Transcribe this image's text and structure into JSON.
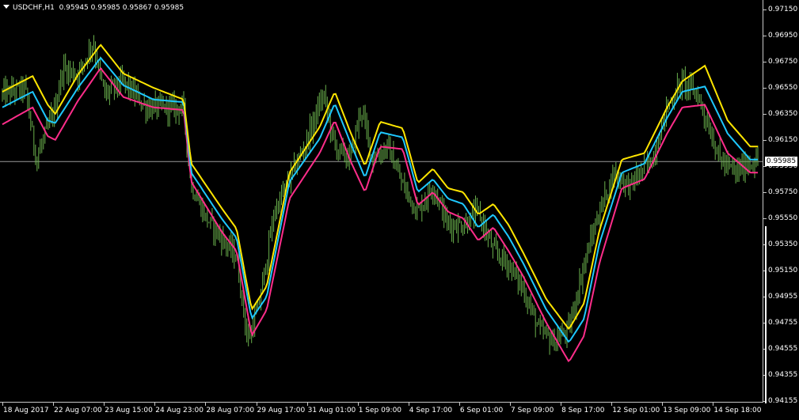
{
  "header": {
    "symbol": "USDCHF,H1",
    "open": "0.95945",
    "high": "0.95985",
    "low": "0.95867",
    "close": "0.95985"
  },
  "price_axis": {
    "labels": [
      "0.97150",
      "0.96950",
      "0.96750",
      "0.96550",
      "0.96350",
      "0.96150",
      "0.95950",
      "0.95750",
      "0.95550",
      "0.95350",
      "0.95150",
      "0.94955",
      "0.94755",
      "0.94555",
      "0.94355",
      "0.94155"
    ],
    "current_price": "0.95985"
  },
  "time_axis": {
    "labels": [
      "18 Aug 2017",
      "22 Aug 07:00",
      "23 Aug 15:00",
      "24 Aug 23:00",
      "28 Aug 07:00",
      "29 Aug 17:00",
      "31 Aug 01:00",
      "1 Sep 09:00",
      "4 Sep 17:00",
      "6 Sep 01:00",
      "7 Sep 09:00",
      "8 Sep 17:00",
      "12 Sep 01:00",
      "13 Sep 09:00",
      "14 Sep 18:00"
    ]
  },
  "colors": {
    "background": "#000000",
    "bars": "#6ab04c",
    "upper_band": "#ffe600",
    "middle_line": "#1ec8ff",
    "lower_band": "#ff2d8a",
    "grid_line": "#c8c8c8",
    "text": "#ffffff"
  },
  "chart_data": {
    "type": "line",
    "title": "USDCHF,H1",
    "price_range": [
      0.9415,
      0.9715
    ],
    "indicator_lines": [
      {
        "color": "yellow",
        "points": [
          [
            0,
            0.9652
          ],
          [
            0.04,
            0.9664
          ],
          [
            0.06,
            0.9642
          ],
          [
            0.07,
            0.9635
          ],
          [
            0.1,
            0.9665
          ],
          [
            0.13,
            0.9688
          ],
          [
            0.16,
            0.9666
          ],
          [
            0.2,
            0.9655
          ],
          [
            0.24,
            0.9646
          ],
          [
            0.25,
            0.9597
          ],
          [
            0.29,
            0.9563
          ],
          [
            0.31,
            0.9547
          ],
          [
            0.33,
            0.9485
          ],
          [
            0.35,
            0.9503
          ],
          [
            0.38,
            0.959
          ],
          [
            0.42,
            0.9625
          ],
          [
            0.44,
            0.9652
          ],
          [
            0.46,
            0.9622
          ],
          [
            0.48,
            0.9595
          ],
          [
            0.5,
            0.9629
          ],
          [
            0.53,
            0.9624
          ],
          [
            0.55,
            0.9582
          ],
          [
            0.57,
            0.9593
          ],
          [
            0.59,
            0.9578
          ],
          [
            0.61,
            0.9575
          ],
          [
            0.63,
            0.9558
          ],
          [
            0.65,
            0.9566
          ],
          [
            0.67,
            0.955
          ],
          [
            0.69,
            0.9528
          ],
          [
            0.72,
            0.9493
          ],
          [
            0.75,
            0.947
          ],
          [
            0.77,
            0.949
          ],
          [
            0.79,
            0.9545
          ],
          [
            0.82,
            0.96
          ],
          [
            0.85,
            0.9605
          ],
          [
            0.88,
            0.964
          ],
          [
            0.9,
            0.966
          ],
          [
            0.93,
            0.9672
          ],
          [
            0.96,
            0.963
          ],
          [
            0.99,
            0.961
          ]
        ]
      },
      {
        "color": "cyan",
        "points": [
          [
            0,
            0.964
          ],
          [
            0.04,
            0.9652
          ],
          [
            0.06,
            0.963
          ],
          [
            0.07,
            0.9628
          ],
          [
            0.1,
            0.9655
          ],
          [
            0.13,
            0.9678
          ],
          [
            0.16,
            0.9657
          ],
          [
            0.2,
            0.9646
          ],
          [
            0.24,
            0.9644
          ],
          [
            0.25,
            0.959
          ],
          [
            0.29,
            0.9555
          ],
          [
            0.31,
            0.954
          ],
          [
            0.33,
            0.9478
          ],
          [
            0.35,
            0.9495
          ],
          [
            0.38,
            0.9583
          ],
          [
            0.42,
            0.9616
          ],
          [
            0.44,
            0.9643
          ],
          [
            0.46,
            0.9614
          ],
          [
            0.48,
            0.9586
          ],
          [
            0.5,
            0.9621
          ],
          [
            0.53,
            0.9617
          ],
          [
            0.55,
            0.9575
          ],
          [
            0.57,
            0.9585
          ],
          [
            0.59,
            0.957
          ],
          [
            0.61,
            0.9566
          ],
          [
            0.63,
            0.9548
          ],
          [
            0.65,
            0.9558
          ],
          [
            0.67,
            0.9541
          ],
          [
            0.69,
            0.952
          ],
          [
            0.72,
            0.9485
          ],
          [
            0.75,
            0.946
          ],
          [
            0.77,
            0.9478
          ],
          [
            0.79,
            0.9535
          ],
          [
            0.82,
            0.959
          ],
          [
            0.85,
            0.9597
          ],
          [
            0.88,
            0.9632
          ],
          [
            0.9,
            0.9652
          ],
          [
            0.93,
            0.9656
          ],
          [
            0.96,
            0.962
          ],
          [
            0.99,
            0.96
          ]
        ]
      },
      {
        "color": "magenta",
        "points": [
          [
            0,
            0.9627
          ],
          [
            0.04,
            0.964
          ],
          [
            0.06,
            0.9618
          ],
          [
            0.07,
            0.9615
          ],
          [
            0.1,
            0.9645
          ],
          [
            0.13,
            0.967
          ],
          [
            0.16,
            0.9648
          ],
          [
            0.2,
            0.964
          ],
          [
            0.24,
            0.9638
          ],
          [
            0.25,
            0.9583
          ],
          [
            0.29,
            0.9545
          ],
          [
            0.31,
            0.953
          ],
          [
            0.33,
            0.9465
          ],
          [
            0.35,
            0.9485
          ],
          [
            0.38,
            0.957
          ],
          [
            0.42,
            0.9605
          ],
          [
            0.44,
            0.963
          ],
          [
            0.46,
            0.96
          ],
          [
            0.48,
            0.9575
          ],
          [
            0.5,
            0.961
          ],
          [
            0.53,
            0.9608
          ],
          [
            0.55,
            0.9565
          ],
          [
            0.57,
            0.9575
          ],
          [
            0.59,
            0.956
          ],
          [
            0.61,
            0.9555
          ],
          [
            0.63,
            0.9538
          ],
          [
            0.65,
            0.9548
          ],
          [
            0.67,
            0.953
          ],
          [
            0.69,
            0.951
          ],
          [
            0.72,
            0.9475
          ],
          [
            0.75,
            0.9445
          ],
          [
            0.77,
            0.9465
          ],
          [
            0.79,
            0.952
          ],
          [
            0.82,
            0.9578
          ],
          [
            0.85,
            0.9585
          ],
          [
            0.88,
            0.962
          ],
          [
            0.9,
            0.964
          ],
          [
            0.93,
            0.9642
          ],
          [
            0.96,
            0.9605
          ],
          [
            0.99,
            0.959
          ]
        ]
      }
    ],
    "price_path": [
      [
        0,
        0.965
      ],
      [
        0.03,
        0.9655
      ],
      [
        0.045,
        0.96
      ],
      [
        0.07,
        0.964
      ],
      [
        0.08,
        0.967
      ],
      [
        0.1,
        0.9665
      ],
      [
        0.12,
        0.969
      ],
      [
        0.135,
        0.965
      ],
      [
        0.16,
        0.966
      ],
      [
        0.19,
        0.964
      ],
      [
        0.22,
        0.964
      ],
      [
        0.24,
        0.964
      ],
      [
        0.25,
        0.958
      ],
      [
        0.27,
        0.9555
      ],
      [
        0.29,
        0.954
      ],
      [
        0.31,
        0.9525
      ],
      [
        0.325,
        0.946
      ],
      [
        0.34,
        0.949
      ],
      [
        0.36,
        0.956
      ],
      [
        0.38,
        0.9585
      ],
      [
        0.4,
        0.961
      ],
      [
        0.425,
        0.965
      ],
      [
        0.44,
        0.961
      ],
      [
        0.46,
        0.96
      ],
      [
        0.475,
        0.964
      ],
      [
        0.49,
        0.96
      ],
      [
        0.51,
        0.961
      ],
      [
        0.53,
        0.958
      ],
      [
        0.55,
        0.956
      ],
      [
        0.57,
        0.958
      ],
      [
        0.59,
        0.955
      ],
      [
        0.61,
        0.955
      ],
      [
        0.63,
        0.956
      ],
      [
        0.65,
        0.953
      ],
      [
        0.67,
        0.952
      ],
      [
        0.69,
        0.95
      ],
      [
        0.71,
        0.947
      ],
      [
        0.73,
        0.946
      ],
      [
        0.75,
        0.947
      ],
      [
        0.77,
        0.952
      ],
      [
        0.79,
        0.956
      ],
      [
        0.81,
        0.959
      ],
      [
        0.83,
        0.958
      ],
      [
        0.86,
        0.96
      ],
      [
        0.88,
        0.964
      ],
      [
        0.9,
        0.966
      ],
      [
        0.92,
        0.965
      ],
      [
        0.95,
        0.96
      ],
      [
        0.97,
        0.959
      ],
      [
        0.99,
        0.9598
      ]
    ]
  }
}
